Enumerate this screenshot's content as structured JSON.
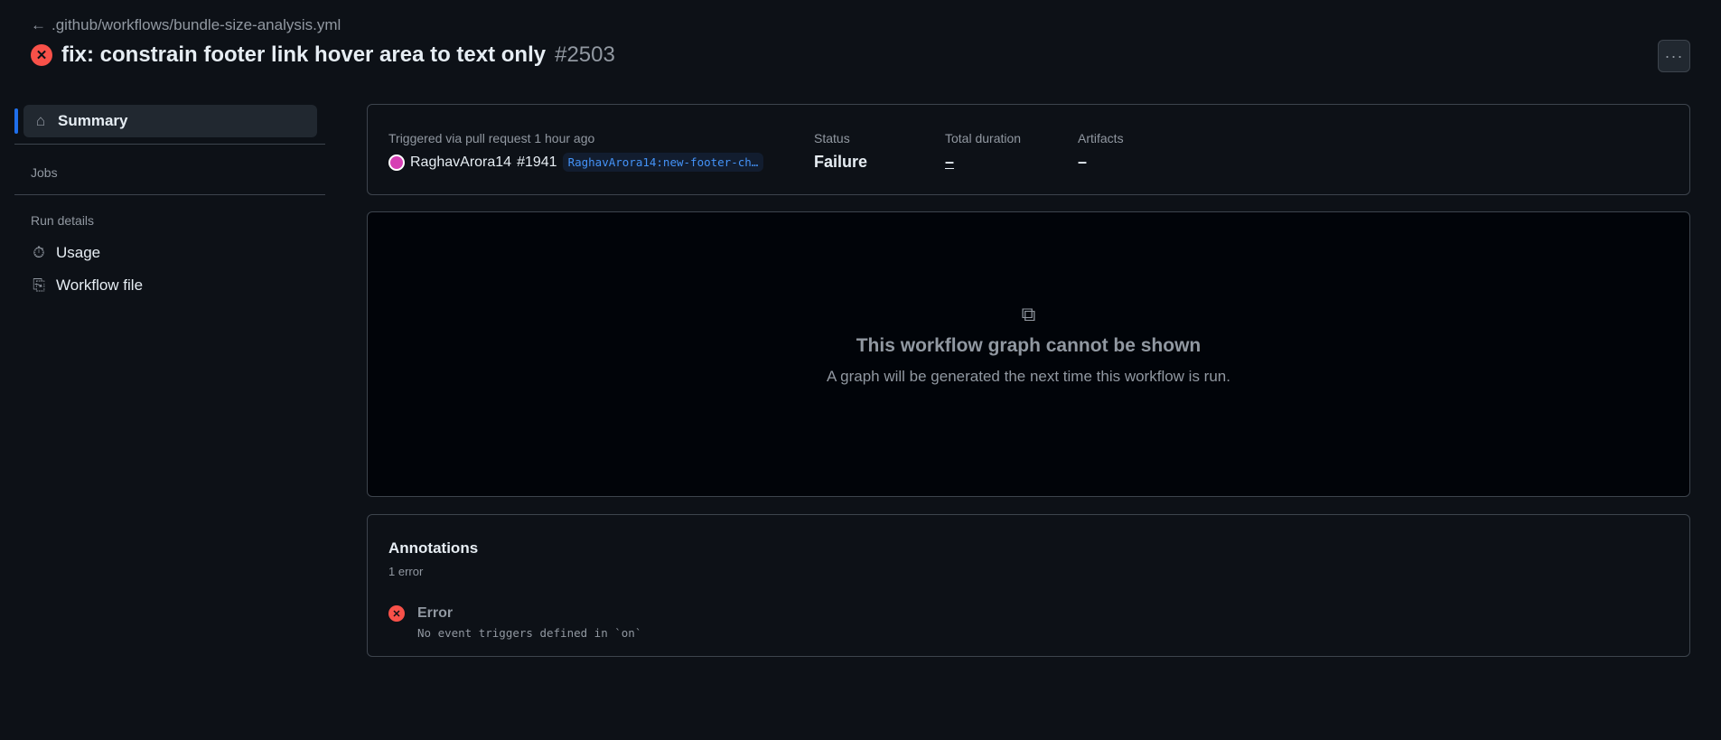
{
  "header": {
    "back_path": ".github/workflows/bundle-size-analysis.yml",
    "title": "fix: constrain footer link hover area to text only",
    "run_number": "#2503",
    "more_label": "···"
  },
  "sidebar": {
    "summary": "Summary",
    "jobs_heading": "Jobs",
    "run_details_heading": "Run details",
    "items": [
      {
        "label": "Usage",
        "icon": "stopwatch-icon"
      },
      {
        "label": "Workflow file",
        "icon": "file-code-icon"
      }
    ]
  },
  "summary_card": {
    "trigger_text": "Triggered via pull request 1 hour ago",
    "actor": "RaghavArora14",
    "pr": "#1941",
    "branch": "RaghavArora14:new-footer-ch…",
    "status_label": "Status",
    "status_value": "Failure",
    "duration_label": "Total duration",
    "duration_value": "–",
    "artifacts_label": "Artifacts",
    "artifacts_value": "–"
  },
  "graph_card": {
    "title": "This workflow graph cannot be shown",
    "subtitle": "A graph will be generated the next time this workflow is run."
  },
  "annotations": {
    "title": "Annotations",
    "count": "1 error",
    "items": [
      {
        "level": "Error",
        "message": "No event triggers defined in `on`"
      }
    ]
  },
  "colors": {
    "accent": "#1f6feb",
    "error": "#f85149",
    "link": "#4493f8"
  }
}
